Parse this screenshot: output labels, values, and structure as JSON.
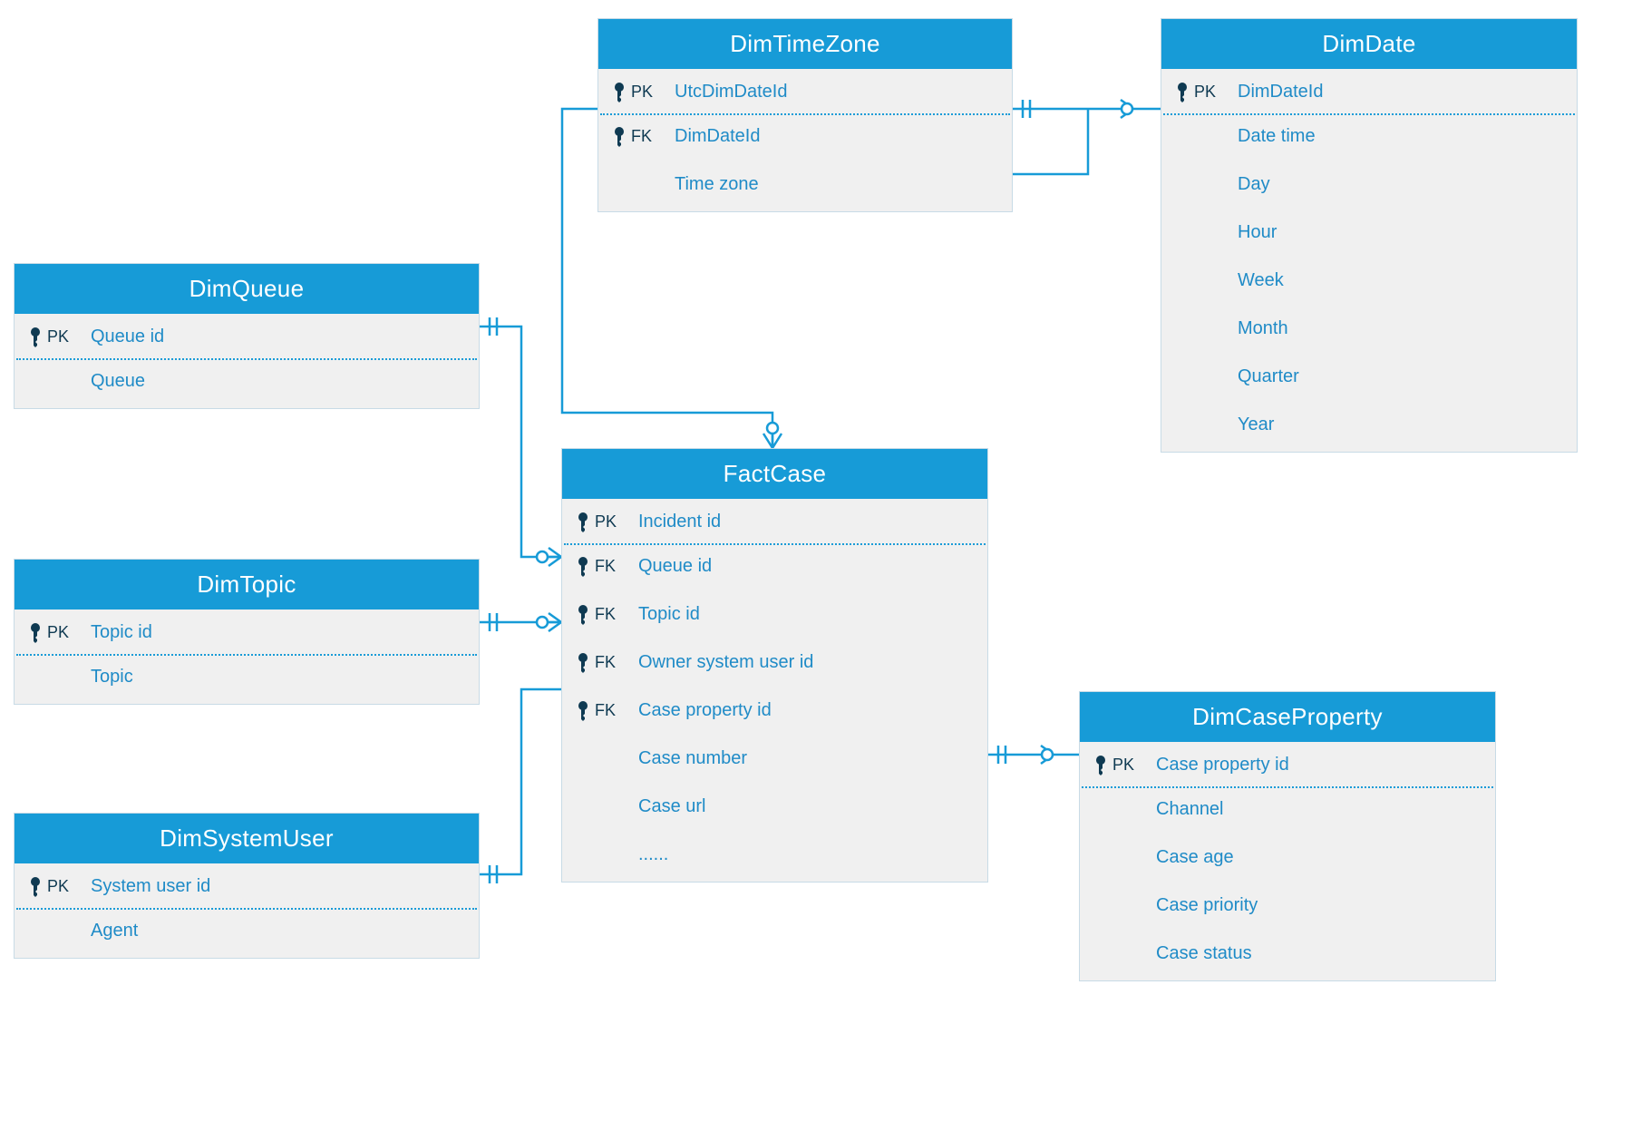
{
  "colors": {
    "header_bg": "#179bd7",
    "header_fg": "#ffffff",
    "body_bg": "#f0f0f0",
    "text": "#1f8bc7",
    "key_text": "#0f3a52",
    "line": "#179bd7"
  },
  "entities": {
    "dimTimeZone": {
      "title": "DimTimeZone",
      "rows": [
        {
          "key": "PK",
          "name": "UtcDimDateId"
        },
        {
          "key": "FK",
          "name": "DimDateId"
        },
        {
          "key": "",
          "name": "Time zone"
        }
      ]
    },
    "dimDate": {
      "title": "DimDate",
      "rows": [
        {
          "key": "PK",
          "name": "DimDateId"
        },
        {
          "key": "",
          "name": "Date time"
        },
        {
          "key": "",
          "name": "Day"
        },
        {
          "key": "",
          "name": "Hour"
        },
        {
          "key": "",
          "name": "Week"
        },
        {
          "key": "",
          "name": "Month"
        },
        {
          "key": "",
          "name": "Quarter"
        },
        {
          "key": "",
          "name": "Year"
        }
      ]
    },
    "dimQueue": {
      "title": "DimQueue",
      "rows": [
        {
          "key": "PK",
          "name": "Queue id"
        },
        {
          "key": "",
          "name": "Queue"
        }
      ]
    },
    "dimTopic": {
      "title": "DimTopic",
      "rows": [
        {
          "key": "PK",
          "name": "Topic id"
        },
        {
          "key": "",
          "name": "Topic"
        }
      ]
    },
    "dimSystemUser": {
      "title": "DimSystemUser",
      "rows": [
        {
          "key": "PK",
          "name": "System user id"
        },
        {
          "key": "",
          "name": "Agent"
        }
      ]
    },
    "factCase": {
      "title": "FactCase",
      "rows": [
        {
          "key": "PK",
          "name": "Incident id"
        },
        {
          "key": "FK",
          "name": "Queue id"
        },
        {
          "key": "FK",
          "name": "Topic id"
        },
        {
          "key": "FK",
          "name": "Owner system user id"
        },
        {
          "key": "FK",
          "name": "Case property id"
        },
        {
          "key": "",
          "name": "Case number"
        },
        {
          "key": "",
          "name": "Case url"
        },
        {
          "key": "",
          "name": "......"
        }
      ]
    },
    "dimCaseProperty": {
      "title": "DimCaseProperty",
      "rows": [
        {
          "key": "PK",
          "name": "Case property id"
        },
        {
          "key": "",
          "name": "Channel"
        },
        {
          "key": "",
          "name": "Case age"
        },
        {
          "key": "",
          "name": "Case priority"
        },
        {
          "key": "",
          "name": "Case status"
        }
      ]
    }
  },
  "relationships": [
    {
      "from": "FactCase.Queue id",
      "to": "DimQueue.Queue id",
      "card": "many-to-one"
    },
    {
      "from": "FactCase.Topic id",
      "to": "DimTopic.Topic id",
      "card": "many-to-one"
    },
    {
      "from": "FactCase.Owner system user id",
      "to": "DimSystemUser.System user id",
      "card": "many-to-one"
    },
    {
      "from": "FactCase.Case property id",
      "to": "DimCaseProperty.Case property id",
      "card": "many-to-one"
    },
    {
      "from": "FactCase",
      "to": "DimTimeZone.UtcDimDateId",
      "card": "many-to-one"
    },
    {
      "from": "DimTimeZone.DimDateId",
      "to": "DimDate.DimDateId",
      "card": "many-to-one"
    }
  ]
}
